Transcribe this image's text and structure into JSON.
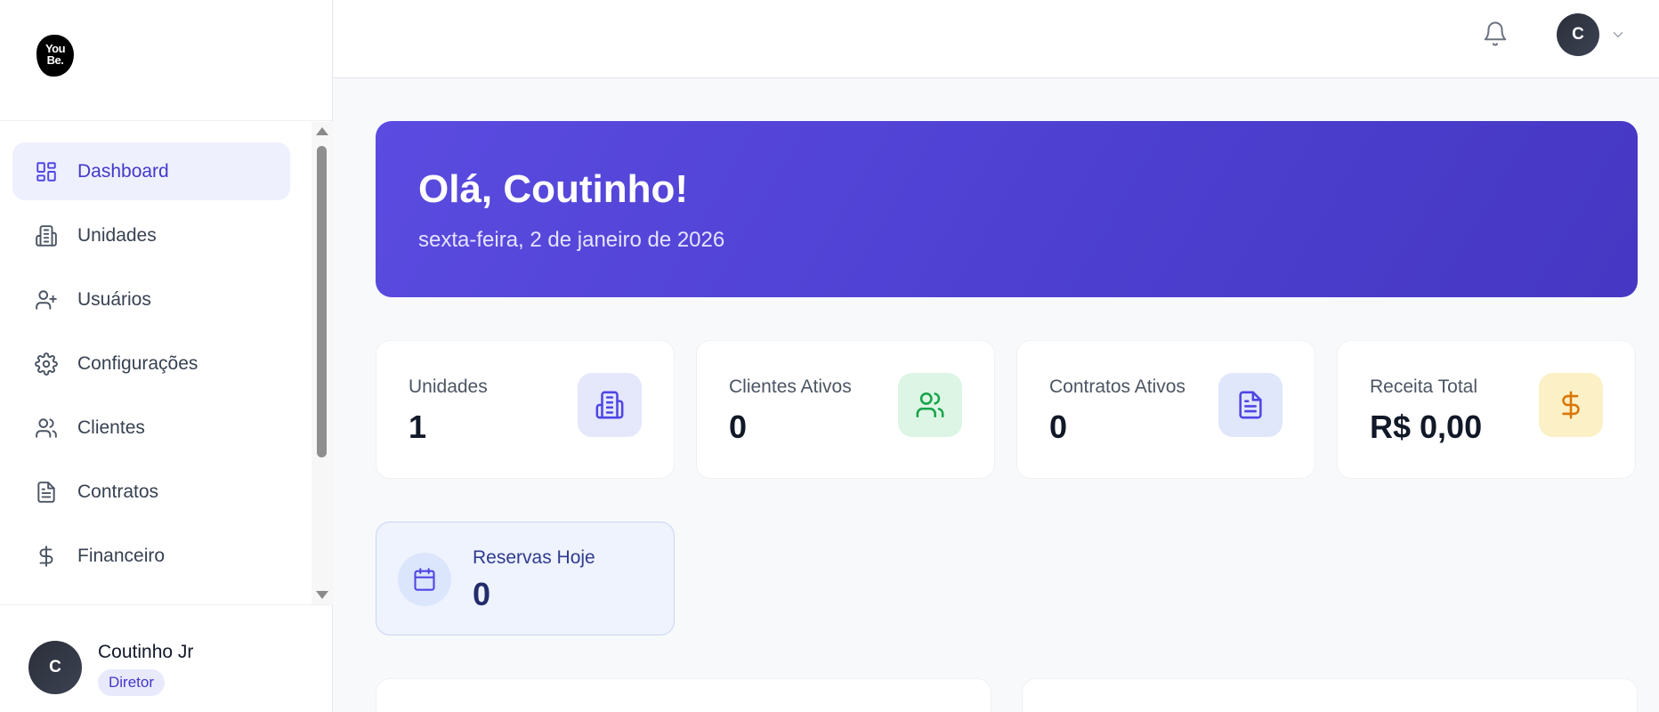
{
  "logo": {
    "line1": "You",
    "line2": "Be."
  },
  "sidebar": {
    "items": [
      {
        "label": "Dashboard",
        "icon": "layout-dashboard-icon",
        "active": true
      },
      {
        "label": "Unidades",
        "icon": "building-icon"
      },
      {
        "label": "Usuários",
        "icon": "user-plus-icon"
      },
      {
        "label": "Configurações",
        "icon": "gear-icon"
      },
      {
        "label": "Clientes",
        "icon": "users-icon"
      },
      {
        "label": "Contratos",
        "icon": "document-icon"
      },
      {
        "label": "Financeiro",
        "icon": "dollar-icon"
      }
    ]
  },
  "user": {
    "initial": "C",
    "name": "Coutinho Jr",
    "role": "Diretor"
  },
  "topbar": {
    "avatar_initial": "C"
  },
  "banner": {
    "title": "Olá, Coutinho!",
    "date": "sexta-feira, 2 de janeiro de 2026"
  },
  "stats": [
    {
      "label": "Unidades",
      "value": "1",
      "icon": "building-icon",
      "icon_bg": "#e5e7fb",
      "icon_color": "#4f46e5"
    },
    {
      "label": "Clientes Ativos",
      "value": "0",
      "icon": "users-icon",
      "icon_bg": "#dcf5e4",
      "icon_color": "#16a34a"
    },
    {
      "label": "Contratos Ativos",
      "value": "0",
      "icon": "document-icon",
      "icon_bg": "#e0e7fb",
      "icon_color": "#4f46e5"
    },
    {
      "label": "Receita Total",
      "value": "R$ 0,00",
      "icon": "dollar-icon",
      "icon_bg": "#fbf0c6",
      "icon_color": "#d97706"
    }
  ],
  "reservas": {
    "label": "Reservas Hoje",
    "value": "0",
    "icon": "calendar-icon"
  }
}
